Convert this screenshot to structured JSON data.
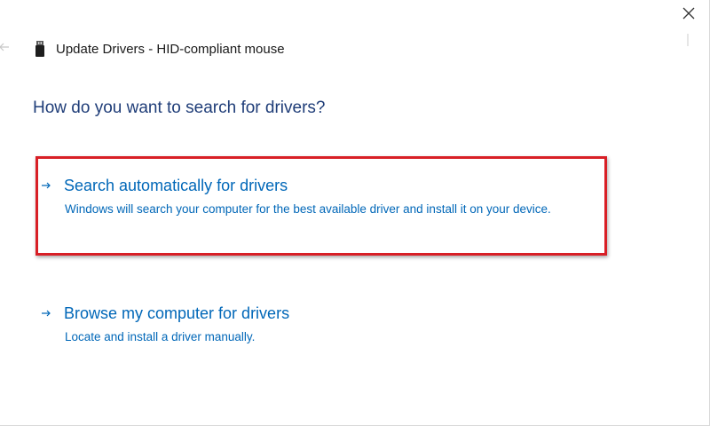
{
  "window": {
    "title": "Update Drivers - HID-compliant mouse",
    "device_icon": "usb-device-icon",
    "close_icon": "close-icon",
    "back_icon": "back-arrow-icon"
  },
  "main": {
    "heading": "How do you want to search for drivers?",
    "options": [
      {
        "title": "Search automatically for drivers",
        "description": "Windows will search your computer for the best available driver and install it on your device.",
        "icon": "arrow-right-icon",
        "highlighted": true
      },
      {
        "title": "Browse my computer for drivers",
        "description": "Locate and install a driver manually.",
        "icon": "arrow-right-icon",
        "highlighted": false
      }
    ]
  },
  "colors": {
    "link": "#0067b8",
    "heading": "#1f3d78",
    "highlight": "#d81f26"
  }
}
